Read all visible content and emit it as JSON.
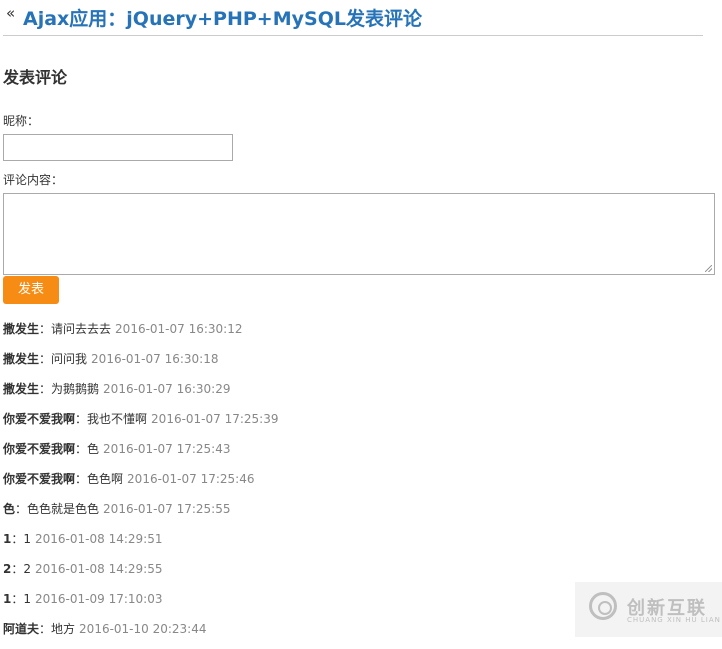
{
  "header": {
    "back_icon": "«",
    "title": "Ajax应用：jQuery+PHP+MySQL发表评论"
  },
  "form": {
    "section_title": "发表评论",
    "nickname_label": "昵称：",
    "nickname_value": "",
    "content_label": "评论内容：",
    "content_value": "",
    "submit_label": "发表"
  },
  "comments": [
    {
      "name": "撒发生",
      "sep": "：",
      "text": "请问去去去",
      "time": "2016-01-07 16:30:12"
    },
    {
      "name": "撒发生",
      "sep": "：",
      "text": "问问我",
      "time": "2016-01-07 16:30:18"
    },
    {
      "name": "撒发生",
      "sep": "：",
      "text": "为鹅鹅鹅",
      "time": "2016-01-07 16:30:29"
    },
    {
      "name": "你爱不爱我啊",
      "sep": "：",
      "text": "我也不懂啊",
      "time": "2016-01-07 17:25:39"
    },
    {
      "name": "你爱不爱我啊",
      "sep": "：",
      "text": "色",
      "time": "2016-01-07 17:25:43"
    },
    {
      "name": "你爱不爱我啊",
      "sep": "：",
      "text": "色色啊",
      "time": "2016-01-07 17:25:46"
    },
    {
      "name": "色",
      "sep": "：",
      "text": "色色就是色色",
      "time": "2016-01-07 17:25:55"
    },
    {
      "name": "1",
      "sep": "：",
      "text": "1",
      "time": "2016-01-08 14:29:51"
    },
    {
      "name": "2",
      "sep": "：",
      "text": "2",
      "time": "2016-01-08 14:29:55"
    },
    {
      "name": "1",
      "sep": "：",
      "text": "1",
      "time": "2016-01-09 17:10:03"
    },
    {
      "name": "阿道夫",
      "sep": "：",
      "text": "地方",
      "time": "2016-01-10 20:23:44"
    }
  ],
  "watermark": {
    "text": "创新互联",
    "subtext": "CHUANG XIN HU LIAN"
  }
}
